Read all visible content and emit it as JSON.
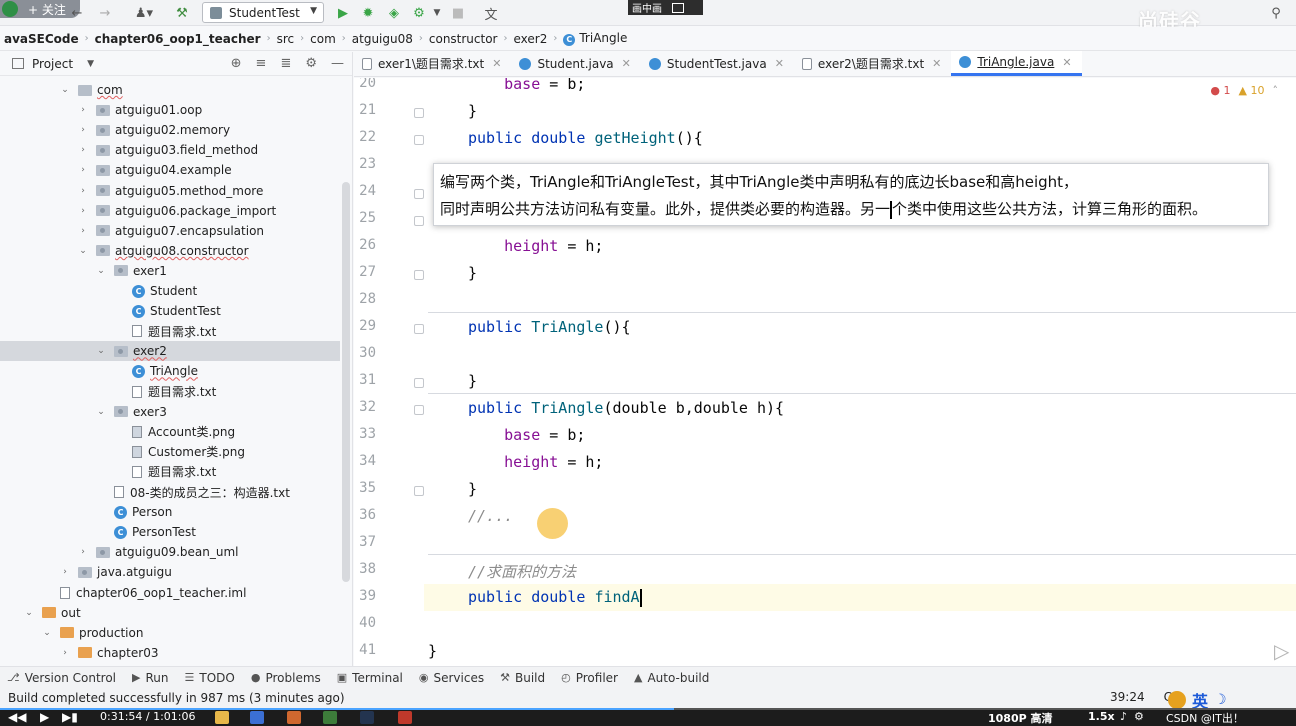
{
  "toolbar": {
    "follow_label": "+ 关注",
    "run_config": "StudentTest",
    "pip_label": "画中画",
    "watermark": "尚硅谷"
  },
  "breadcrumb": [
    "avaSECode",
    "chapter06_oop1_teacher",
    "src",
    "com",
    "atguigu08",
    "constructor",
    "exer2",
    "TriAngle"
  ],
  "project": {
    "title": "Project",
    "tree": [
      {
        "label": "com",
        "depth": 0,
        "arrow": "down",
        "icon": "folder"
      },
      {
        "label": "atguigu01.oop",
        "depth": 1,
        "arrow": "right",
        "icon": "pkg"
      },
      {
        "label": "atguigu02.memory",
        "depth": 1,
        "arrow": "right",
        "icon": "pkg"
      },
      {
        "label": "atguigu03.field_method",
        "depth": 1,
        "arrow": "right",
        "icon": "pkg"
      },
      {
        "label": "atguigu04.example",
        "depth": 1,
        "arrow": "right",
        "icon": "pkg"
      },
      {
        "label": "atguigu05.method_more",
        "depth": 1,
        "arrow": "right",
        "icon": "pkg"
      },
      {
        "label": "atguigu06.package_import",
        "depth": 1,
        "arrow": "right",
        "icon": "pkg"
      },
      {
        "label": "atguigu07.encapsulation",
        "depth": 1,
        "arrow": "right",
        "icon": "pkg"
      },
      {
        "label": "atguigu08.constructor",
        "depth": 1,
        "arrow": "down",
        "icon": "pkg"
      },
      {
        "label": "exer1",
        "depth": 2,
        "arrow": "down",
        "icon": "pkg"
      },
      {
        "label": "Student",
        "depth": 3,
        "arrow": "",
        "icon": "class"
      },
      {
        "label": "StudentTest",
        "depth": 3,
        "arrow": "",
        "icon": "class"
      },
      {
        "label": "题目需求.txt",
        "depth": 3,
        "arrow": "",
        "icon": "file"
      },
      {
        "label": "exer2",
        "depth": 2,
        "arrow": "down",
        "icon": "pkg"
      },
      {
        "label": "TriAngle",
        "depth": 3,
        "arrow": "",
        "icon": "class"
      },
      {
        "label": "题目需求.txt",
        "depth": 3,
        "arrow": "",
        "icon": "file"
      },
      {
        "label": "exer3",
        "depth": 2,
        "arrow": "down",
        "icon": "pkg"
      },
      {
        "label": "Account类.png",
        "depth": 3,
        "arrow": "",
        "icon": "img"
      },
      {
        "label": "Customer类.png",
        "depth": 3,
        "arrow": "",
        "icon": "img"
      },
      {
        "label": "题目需求.txt",
        "depth": 3,
        "arrow": "",
        "icon": "file"
      },
      {
        "label": "08-类的成员之三：构造器.txt",
        "depth": 2,
        "arrow": "",
        "icon": "file"
      },
      {
        "label": "Person",
        "depth": 2,
        "arrow": "",
        "icon": "class"
      },
      {
        "label": "PersonTest",
        "depth": 2,
        "arrow": "",
        "icon": "class"
      },
      {
        "label": "atguigu09.bean_uml",
        "depth": 1,
        "arrow": "right",
        "icon": "pkg"
      },
      {
        "label": "java.atguigu",
        "depth": 0,
        "arrow": "right",
        "icon": "pkg"
      },
      {
        "label": "chapter06_oop1_teacher.iml",
        "depth": -1,
        "arrow": "",
        "icon": "file"
      },
      {
        "label": "out",
        "depth": -2,
        "arrow": "down",
        "icon": "orange"
      },
      {
        "label": "production",
        "depth": -1,
        "arrow": "down",
        "icon": "orange"
      },
      {
        "label": "chapter03",
        "depth": 0,
        "arrow": "right",
        "icon": "orange"
      }
    ]
  },
  "tabs": [
    {
      "label": "exer1\\题目需求.txt",
      "icon": "txt"
    },
    {
      "label": "Student.java",
      "icon": "cls"
    },
    {
      "label": "StudentTest.java",
      "icon": "cls"
    },
    {
      "label": "exer2\\题目需求.txt",
      "icon": "txt"
    },
    {
      "label": "TriAngle.java",
      "icon": "cls",
      "active": true
    }
  ],
  "inspections": {
    "errors": "1",
    "warnings": "10"
  },
  "line_numbers": [
    "20",
    "21",
    "22",
    "23",
    "24",
    "25",
    "26",
    "27",
    "28",
    "29",
    "30",
    "31",
    "32",
    "33",
    "34",
    "35",
    "36",
    "37",
    "38",
    "39",
    "40",
    "41"
  ],
  "code": {
    "l20": [
      "    ",
      "base",
      " = b;"
    ],
    "l21": "}",
    "l22": [
      "public double ",
      "getHeight",
      "(){"
    ],
    "l26": [
      "    ",
      "height",
      " = h;"
    ],
    "l27": "}",
    "l29": [
      "public ",
      "TriAngle",
      "(){"
    ],
    "l31": "}",
    "l32": [
      "public ",
      "TriAngle",
      "(double b,double h){"
    ],
    "l33": [
      "    ",
      "base",
      " = b;"
    ],
    "l34": [
      "    ",
      "height",
      " = h;"
    ],
    "l35": "}",
    "l36": "//...",
    "l38": "//求面积的方法",
    "l39": [
      "public double ",
      "findA"
    ],
    "l41": "}"
  },
  "tooltip": {
    "line1": "编写两个类，TriAngle和TriAngleTest，其中TriAngle类中声明私有的底边长base和高height，",
    "line2a": "同时声明公共方法访问私有变量。此外，提供类必要的构造器。另一",
    "line2b": "个类中使用这些公共方法，计算三角形的面积。"
  },
  "tool_tabs": [
    {
      "label": "Version Control",
      "icon": "vcs-icon"
    },
    {
      "label": "Run",
      "icon": "run-icon"
    },
    {
      "label": "TODO",
      "icon": "todo-icon"
    },
    {
      "label": "Problems",
      "icon": "problems-icon"
    },
    {
      "label": "Terminal",
      "icon": "terminal-icon"
    },
    {
      "label": "Services",
      "icon": "services-icon"
    },
    {
      "label": "Build",
      "icon": "build-icon"
    },
    {
      "label": "Profiler",
      "icon": "profiler-icon"
    },
    {
      "label": "Auto-build",
      "icon": "autobuild-icon"
    }
  ],
  "status": {
    "message": "Build completed successfully in 987 ms (3 minutes ago)",
    "position": "39:24",
    "encoding_fragment": "CI",
    "ime": "英"
  },
  "video": {
    "time": "0:31:54 / 1:01:06",
    "quality": "1080P 高清",
    "speed": "1.5x",
    "credit": "CSDN @IT出！",
    "progress": 0.52
  }
}
